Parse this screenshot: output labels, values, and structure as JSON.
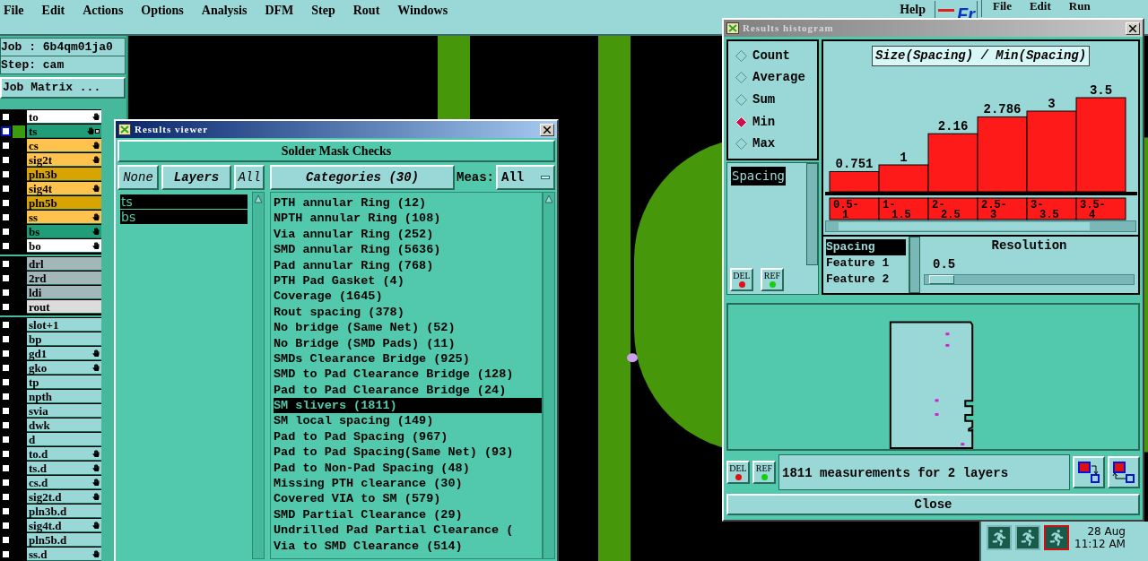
{
  "menu_bar": {
    "items": [
      "File",
      "Edit",
      "Actions",
      "Options",
      "Analysis",
      "DFM",
      "Step",
      "Rout",
      "Windows"
    ],
    "help": "Help",
    "logo": "Fr"
  },
  "second_menu": {
    "items": [
      "File",
      "Edit",
      "Run"
    ]
  },
  "job_panel": {
    "job": "Job : 6b4qm01ja0",
    "step": "Step: cam",
    "matrix_button": "Job Matrix ..."
  },
  "layer_groups": [
    {
      "layers": [
        {
          "name": "to",
          "color": "#ffffff",
          "checked": false,
          "selected": false,
          "hand": true
        },
        {
          "name": "ts",
          "color": "#1f9e78",
          "checked": false,
          "selected": true,
          "hand": true
        },
        {
          "name": "cs",
          "color": "#ffc34d",
          "checked": false,
          "selected": false,
          "hand": true
        },
        {
          "name": "sig2t",
          "color": "#ffc34d",
          "checked": false,
          "selected": false,
          "hand": true
        },
        {
          "name": "pln3b",
          "color": "#d9a400",
          "checked": false,
          "selected": false,
          "hand": false
        },
        {
          "name": "sig4t",
          "color": "#ffc34d",
          "checked": false,
          "selected": false,
          "hand": true
        },
        {
          "name": "pln5b",
          "color": "#d9a400",
          "checked": false,
          "selected": false,
          "hand": false
        },
        {
          "name": "ss",
          "color": "#ffc34d",
          "checked": false,
          "selected": false,
          "hand": true
        },
        {
          "name": "bs",
          "color": "#1f9e78",
          "checked": false,
          "selected": false,
          "hand": true
        },
        {
          "name": "bo",
          "color": "#ffffff",
          "checked": false,
          "selected": false,
          "hand": true
        }
      ]
    },
    {
      "layers": [
        {
          "name": "drl",
          "color": "#a3b6ba",
          "checked": false,
          "selected": false,
          "hand": false
        },
        {
          "name": "2rd",
          "color": "#a3b6ba",
          "checked": false,
          "selected": false,
          "hand": false
        },
        {
          "name": "ldi",
          "color": "#a3b6ba",
          "checked": false,
          "selected": false,
          "hand": false
        },
        {
          "name": "rout",
          "color": "#dcdcdc",
          "checked": false,
          "selected": false,
          "hand": false
        }
      ]
    },
    {
      "layers": [
        {
          "name": "slot+1",
          "color": "#9ad8d8",
          "checked": false,
          "selected": false,
          "hand": false
        },
        {
          "name": "bp",
          "color": "#9ad8d8",
          "checked": false,
          "selected": false,
          "hand": false
        },
        {
          "name": "gd1",
          "color": "#9ad8d8",
          "checked": false,
          "selected": false,
          "hand": true
        },
        {
          "name": "gko",
          "color": "#9ad8d8",
          "checked": false,
          "selected": false,
          "hand": true
        },
        {
          "name": "tp",
          "color": "#9ad8d8",
          "checked": false,
          "selected": false,
          "hand": false
        },
        {
          "name": "npth",
          "color": "#9ad8d8",
          "checked": false,
          "selected": false,
          "hand": false
        },
        {
          "name": "svia",
          "color": "#9ad8d8",
          "checked": false,
          "selected": false,
          "hand": false
        },
        {
          "name": "dwk",
          "color": "#9ad8d8",
          "checked": false,
          "selected": false,
          "hand": false
        },
        {
          "name": "d",
          "color": "#9ad8d8",
          "checked": false,
          "selected": false,
          "hand": false
        },
        {
          "name": "to.d",
          "color": "#9ad8d8",
          "checked": false,
          "selected": false,
          "hand": true
        },
        {
          "name": "ts.d",
          "color": "#9ad8d8",
          "checked": false,
          "selected": false,
          "hand": true
        },
        {
          "name": "cs.d",
          "color": "#9ad8d8",
          "checked": false,
          "selected": false,
          "hand": true
        },
        {
          "name": "sig2t.d",
          "color": "#9ad8d8",
          "checked": false,
          "selected": false,
          "hand": true
        },
        {
          "name": "pln3b.d",
          "color": "#9ad8d8",
          "checked": false,
          "selected": false,
          "hand": false
        },
        {
          "name": "sig4t.d",
          "color": "#9ad8d8",
          "checked": false,
          "selected": false,
          "hand": true
        },
        {
          "name": "pln5b.d",
          "color": "#9ad8d8",
          "checked": false,
          "selected": false,
          "hand": false
        },
        {
          "name": "ss.d",
          "color": "#9ad8d8",
          "checked": false,
          "selected": false,
          "hand": true
        }
      ]
    }
  ],
  "results_viewer": {
    "title": "Results viewer",
    "check_set": "Solder Mask Checks",
    "none_button": "None",
    "layers_button": "Layers",
    "all_button": "All",
    "categories_button": "Categories (30)",
    "meas_label": "Meas:",
    "meas_value": "All",
    "layers": [
      {
        "name": "ts",
        "selected": true
      },
      {
        "name": "bs",
        "selected": true
      }
    ],
    "categories": [
      {
        "label": "PTH annular Ring (12)",
        "selected": false
      },
      {
        "label": "NPTH annular Ring (108)",
        "selected": false
      },
      {
        "label": "Via annular Ring (252)",
        "selected": false
      },
      {
        "label": "SMD annular Ring (5636)",
        "selected": false
      },
      {
        "label": "Pad annular Ring (768)",
        "selected": false
      },
      {
        "label": "PTH Pad Gasket (4)",
        "selected": false
      },
      {
        "label": "Coverage (1645)",
        "selected": false
      },
      {
        "label": "Rout spacing (378)",
        "selected": false
      },
      {
        "label": "No bridge (Same Net) (52)",
        "selected": false
      },
      {
        "label": "No Bridge (SMD Pads) (11)",
        "selected": false
      },
      {
        "label": "SMDs Clearance Bridge (925)",
        "selected": false
      },
      {
        "label": "SMD to Pad Clearance Bridge (128)",
        "selected": false
      },
      {
        "label": "Pad to Pad Clearance Bridge (24)",
        "selected": false
      },
      {
        "label": "SM slivers (1811)",
        "selected": true
      },
      {
        "label": "SM local spacing (149)",
        "selected": false
      },
      {
        "label": "Pad to Pad Spacing (967)",
        "selected": false
      },
      {
        "label": "Pad to Pad Spacing(Same Net) (93)",
        "selected": false
      },
      {
        "label": "Pad to Non-Pad Spacing (48)",
        "selected": false
      },
      {
        "label": "Missing PTH clearance (30)",
        "selected": false
      },
      {
        "label": "Covered VIA to SM (579)",
        "selected": false
      },
      {
        "label": "SMD Partial Clearance (29)",
        "selected": false
      },
      {
        "label": "Undrilled Pad Partial Clearance (",
        "selected": false
      },
      {
        "label": "Via to SMD Clearance (514)",
        "selected": false
      }
    ]
  },
  "histogram": {
    "title": "Results histogram",
    "modes": [
      {
        "label": "Count",
        "selected": false
      },
      {
        "label": "Average",
        "selected": false
      },
      {
        "label": "Sum",
        "selected": false
      },
      {
        "label": "Min",
        "selected": true
      },
      {
        "label": "Max",
        "selected": false
      }
    ],
    "attributes": [
      {
        "label": "Spacing",
        "selected": true
      }
    ],
    "del_button": "DEL",
    "ref_button": "REF",
    "chart_data": {
      "type": "bar",
      "title": "Size(Spacing) / Min(Spacing)",
      "categories": [
        "0.5-1",
        "1-1.5",
        "2-2.5",
        "2.5-3",
        "3-3.5",
        "3.5-4"
      ],
      "values": [
        0.751,
        1,
        2.16,
        2.786,
        3,
        3.5
      ],
      "data_labels": true
    },
    "fields": [
      {
        "label": "Spacing",
        "selected": true
      },
      {
        "label": "Feature 1",
        "selected": false
      },
      {
        "label": "Feature 2",
        "selected": false
      }
    ],
    "resolution": {
      "label": "Resolution",
      "value": "0.5",
      "level": 0.02
    },
    "bottom_del": "DEL",
    "bottom_ref": "REF",
    "status": "1811 measurements for 2 layers",
    "close": "Close"
  },
  "taskbar": {
    "apps": [
      {
        "alert": false
      },
      {
        "alert": false
      },
      {
        "alert": true
      }
    ],
    "date": "28 Aug",
    "time": "11:12 AM"
  }
}
